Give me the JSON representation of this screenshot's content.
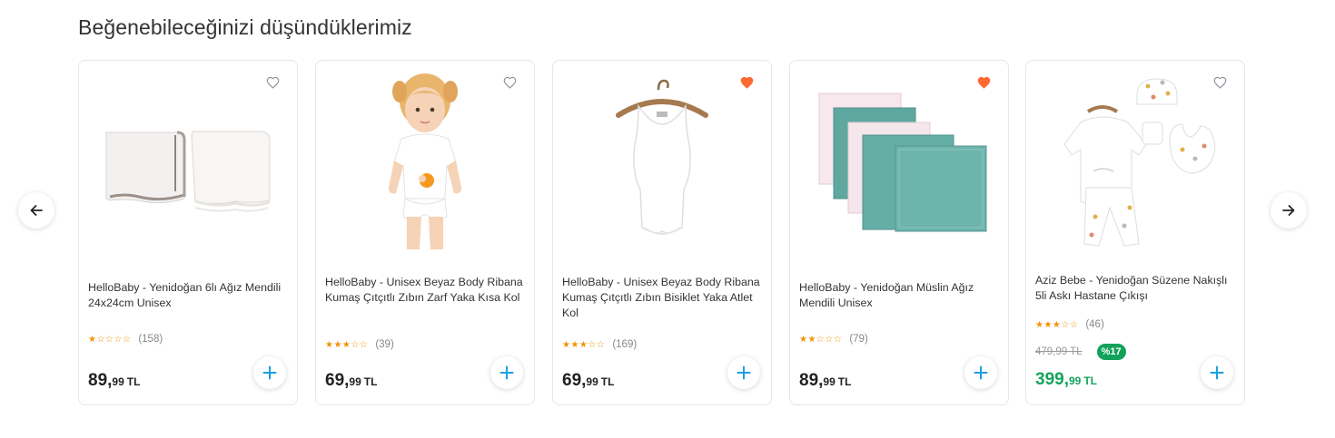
{
  "section": {
    "title": "Beğenebileceğinizi düşündüklerimiz"
  },
  "colors": {
    "accent": "#1a9fe0",
    "star": "#f29200",
    "fav_active": "#ff6a33",
    "discount": "#13a45a"
  },
  "icons": {
    "prev": "arrow-left-icon",
    "next": "arrow-right-icon",
    "favorite": "heart-icon",
    "add": "plus-icon"
  },
  "products": [
    {
      "name": "HelloBaby - Yenidoğan 6lı Ağız Mendili 24x24cm Unisex",
      "stars": "★☆☆☆☆",
      "rating_value": 1,
      "review_count": "(158)",
      "price_int": "89,",
      "price_dec": "99",
      "currency": "TL",
      "favorite": false
    },
    {
      "name": "HelloBaby - Unisex Beyaz Body Ribana Kumaş Çıtçıtlı Zıbın Zarf Yaka Kısa Kol",
      "stars": "★★★☆☆",
      "rating_value": 3,
      "review_count": "(39)",
      "price_int": "69,",
      "price_dec": "99",
      "currency": "TL",
      "favorite": false
    },
    {
      "name": "HelloBaby - Unisex Beyaz Body Ribana Kumaş Çıtçıtlı Zıbın Bisiklet Yaka Atlet Kol",
      "stars": "★★★☆☆",
      "rating_value": 3,
      "review_count": "(169)",
      "price_int": "69,",
      "price_dec": "99",
      "currency": "TL",
      "favorite": true
    },
    {
      "name": "HelloBaby - Yenidoğan Müslin Ağız Mendili Unisex",
      "stars": "★★☆☆☆",
      "rating_value": 2,
      "review_count": "(79)",
      "price_int": "89,",
      "price_dec": "99",
      "currency": "TL",
      "favorite": true
    },
    {
      "name": "Aziz Bebe - Yenidoğan Süzene Nakışlı 5li Askı Hastane Çıkışı",
      "stars": "★★★☆☆",
      "rating_value": 3,
      "review_count": "(46)",
      "old_price": "479,99 TL",
      "discount": "%17",
      "price_int": "399,",
      "price_dec": "99",
      "currency": "TL",
      "favorite": false
    }
  ]
}
